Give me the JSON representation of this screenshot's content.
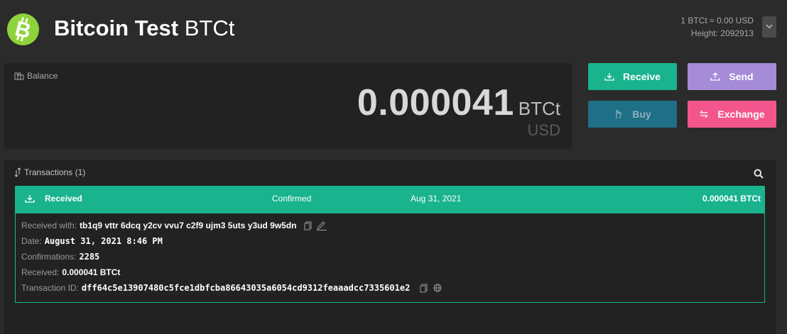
{
  "header": {
    "coin_name": "Bitcoin Test",
    "ticker": "BTCt",
    "rate": "1 BTCt ≈ 0.00 USD",
    "height": "Height: 2092913",
    "logo_color": "#8ed33b"
  },
  "balance": {
    "label": "Balance",
    "amount": "0.000041",
    "unit": "BTCt",
    "fiat_unit": "USD"
  },
  "actions": {
    "receive": "Receive",
    "send": "Send",
    "buy": "Buy",
    "exchange": "Exchange",
    "colors": {
      "receive": "#19b38e",
      "send": "#a68bd8",
      "buy": "#1f6f86",
      "exchange": "#f3568d"
    }
  },
  "transactions": {
    "title": "Transactions (1)",
    "items": [
      {
        "direction": "Received",
        "status": "Confirmed",
        "date": "Aug 31, 2021",
        "amount": "0.000041 BTCt",
        "details": {
          "received_with_label": "Received with:",
          "received_with": "tb1q9 vttr 6dcq y2cv vvu7 c2f9 ujm3 5uts y3ud 9w5dn",
          "date_label": "Date:",
          "date": "August 31, 2021 8:46 PM",
          "confirmations_label": "Confirmations:",
          "confirmations": "2285",
          "received_label": "Received:",
          "received": "0.000041 BTCt",
          "txid_label": "Transaction ID:",
          "txid": "dff64c5e13907480c5fce1dbfcba86643035a6054cd9312feaaadcc7335601e2"
        }
      }
    ]
  },
  "icons": [
    "bitcoin-logo-icon",
    "chevron-down-icon",
    "wallet-icon",
    "download-icon",
    "upload-icon",
    "hand-icon",
    "exchange-icon",
    "transfer-arrows-icon",
    "search-icon",
    "copy-icon",
    "edit-icon",
    "globe-icon"
  ]
}
